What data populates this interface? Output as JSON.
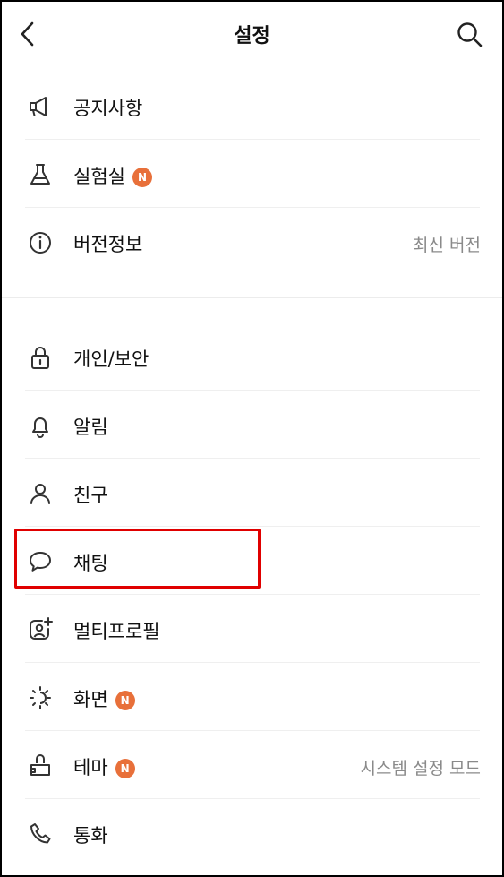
{
  "header": {
    "title": "설정",
    "back_icon": "chevron-left-icon",
    "search_icon": "search-icon"
  },
  "section1": {
    "items": [
      {
        "label": "공지사항",
        "icon": "megaphone-icon"
      },
      {
        "label": "실험실",
        "icon": "flask-icon",
        "badge": "N"
      },
      {
        "label": "버전정보",
        "icon": "info-icon",
        "value": "최신 버전"
      }
    ]
  },
  "section2": {
    "items": [
      {
        "label": "개인/보안",
        "icon": "lock-icon"
      },
      {
        "label": "알림",
        "icon": "bell-icon"
      },
      {
        "label": "친구",
        "icon": "person-icon"
      },
      {
        "label": "채팅",
        "icon": "chat-bubble-icon"
      },
      {
        "label": "멀티프로필",
        "icon": "add-profile-icon"
      },
      {
        "label": "화면",
        "icon": "brightness-icon",
        "badge": "N"
      },
      {
        "label": "테마",
        "icon": "paint-bucket-icon",
        "badge": "N",
        "value": "시스템 설정 모드"
      },
      {
        "label": "통화",
        "icon": "phone-icon"
      }
    ]
  },
  "colors": {
    "badge": "#e8703a",
    "highlight": "#e00000",
    "secondary_text": "#8a8a8a"
  }
}
